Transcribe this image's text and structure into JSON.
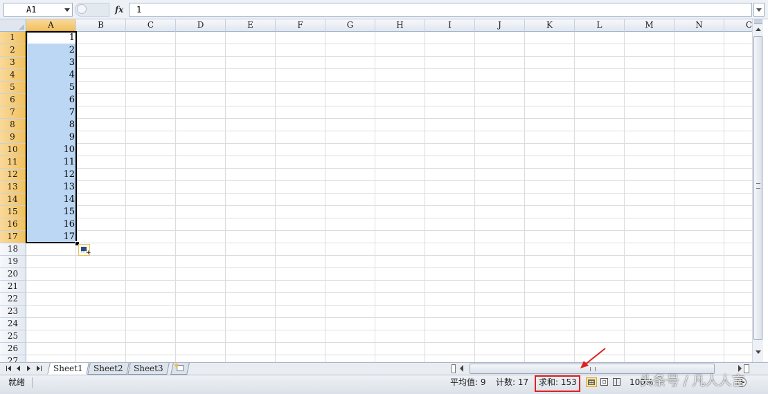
{
  "formula_bar": {
    "name_box": "A1",
    "fx_label": "fx",
    "formula_value": "1"
  },
  "columns": [
    "A",
    "B",
    "C",
    "D",
    "E",
    "F",
    "G",
    "H",
    "I",
    "J",
    "K",
    "L",
    "M",
    "N",
    "C"
  ],
  "rows": [
    "1",
    "2",
    "3",
    "4",
    "5",
    "6",
    "7",
    "8",
    "9",
    "10",
    "11",
    "12",
    "13",
    "14",
    "15",
    "16",
    "17",
    "18",
    "19",
    "20",
    "21",
    "22",
    "23",
    "24",
    "25",
    "26",
    "27"
  ],
  "cells_column_a": [
    "1",
    "2",
    "3",
    "4",
    "5",
    "6",
    "7",
    "8",
    "9",
    "10",
    "11",
    "12",
    "13",
    "14",
    "15",
    "16",
    "17"
  ],
  "selection": {
    "range": "A1:A17",
    "selected_column": "A",
    "selected_rows": 17
  },
  "sheet_tabs": {
    "sheets": [
      "Sheet1",
      "Sheet2",
      "Sheet3"
    ],
    "active": "Sheet1"
  },
  "status_bar": {
    "ready": "就绪",
    "average": "平均值: 9",
    "count": "计数: 17",
    "sum": "求和: 153",
    "zoom": "100%"
  },
  "watermark": "头条号 / 凡人人言",
  "colors": {
    "selection_fill": "#bcd7f4",
    "header_selected": "#f1c15f",
    "annotation_red": "#e02020"
  }
}
